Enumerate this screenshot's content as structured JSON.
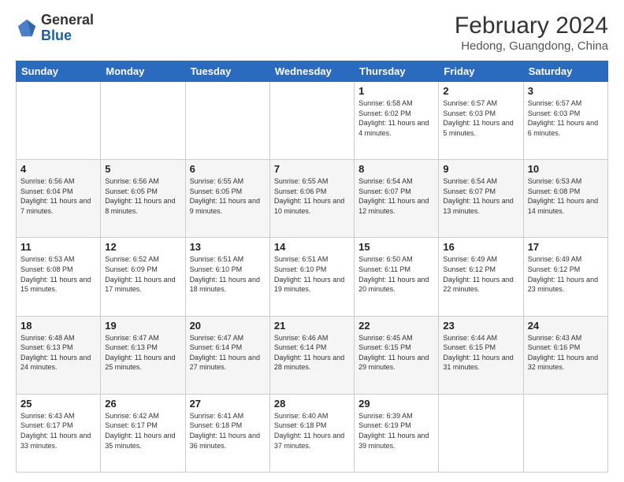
{
  "header": {
    "logo_general": "General",
    "logo_blue": "Blue",
    "month_year": "February 2024",
    "location": "Hedong, Guangdong, China"
  },
  "weekdays": [
    "Sunday",
    "Monday",
    "Tuesday",
    "Wednesday",
    "Thursday",
    "Friday",
    "Saturday"
  ],
  "weeks": [
    [
      {
        "day": "",
        "info": ""
      },
      {
        "day": "",
        "info": ""
      },
      {
        "day": "",
        "info": ""
      },
      {
        "day": "",
        "info": ""
      },
      {
        "day": "1",
        "info": "Sunrise: 6:58 AM\nSunset: 6:02 PM\nDaylight: 11 hours\nand 4 minutes."
      },
      {
        "day": "2",
        "info": "Sunrise: 6:57 AM\nSunset: 6:03 PM\nDaylight: 11 hours\nand 5 minutes."
      },
      {
        "day": "3",
        "info": "Sunrise: 6:57 AM\nSunset: 6:03 PM\nDaylight: 11 hours\nand 6 minutes."
      }
    ],
    [
      {
        "day": "4",
        "info": "Sunrise: 6:56 AM\nSunset: 6:04 PM\nDaylight: 11 hours\nand 7 minutes."
      },
      {
        "day": "5",
        "info": "Sunrise: 6:56 AM\nSunset: 6:05 PM\nDaylight: 11 hours\nand 8 minutes."
      },
      {
        "day": "6",
        "info": "Sunrise: 6:55 AM\nSunset: 6:05 PM\nDaylight: 11 hours\nand 9 minutes."
      },
      {
        "day": "7",
        "info": "Sunrise: 6:55 AM\nSunset: 6:06 PM\nDaylight: 11 hours\nand 10 minutes."
      },
      {
        "day": "8",
        "info": "Sunrise: 6:54 AM\nSunset: 6:07 PM\nDaylight: 11 hours\nand 12 minutes."
      },
      {
        "day": "9",
        "info": "Sunrise: 6:54 AM\nSunset: 6:07 PM\nDaylight: 11 hours\nand 13 minutes."
      },
      {
        "day": "10",
        "info": "Sunrise: 6:53 AM\nSunset: 6:08 PM\nDaylight: 11 hours\nand 14 minutes."
      }
    ],
    [
      {
        "day": "11",
        "info": "Sunrise: 6:53 AM\nSunset: 6:08 PM\nDaylight: 11 hours\nand 15 minutes."
      },
      {
        "day": "12",
        "info": "Sunrise: 6:52 AM\nSunset: 6:09 PM\nDaylight: 11 hours\nand 17 minutes."
      },
      {
        "day": "13",
        "info": "Sunrise: 6:51 AM\nSunset: 6:10 PM\nDaylight: 11 hours\nand 18 minutes."
      },
      {
        "day": "14",
        "info": "Sunrise: 6:51 AM\nSunset: 6:10 PM\nDaylight: 11 hours\nand 19 minutes."
      },
      {
        "day": "15",
        "info": "Sunrise: 6:50 AM\nSunset: 6:11 PM\nDaylight: 11 hours\nand 20 minutes."
      },
      {
        "day": "16",
        "info": "Sunrise: 6:49 AM\nSunset: 6:12 PM\nDaylight: 11 hours\nand 22 minutes."
      },
      {
        "day": "17",
        "info": "Sunrise: 6:49 AM\nSunset: 6:12 PM\nDaylight: 11 hours\nand 23 minutes."
      }
    ],
    [
      {
        "day": "18",
        "info": "Sunrise: 6:48 AM\nSunset: 6:13 PM\nDaylight: 11 hours\nand 24 minutes."
      },
      {
        "day": "19",
        "info": "Sunrise: 6:47 AM\nSunset: 6:13 PM\nDaylight: 11 hours\nand 25 minutes."
      },
      {
        "day": "20",
        "info": "Sunrise: 6:47 AM\nSunset: 6:14 PM\nDaylight: 11 hours\nand 27 minutes."
      },
      {
        "day": "21",
        "info": "Sunrise: 6:46 AM\nSunset: 6:14 PM\nDaylight: 11 hours\nand 28 minutes."
      },
      {
        "day": "22",
        "info": "Sunrise: 6:45 AM\nSunset: 6:15 PM\nDaylight: 11 hours\nand 29 minutes."
      },
      {
        "day": "23",
        "info": "Sunrise: 6:44 AM\nSunset: 6:15 PM\nDaylight: 11 hours\nand 31 minutes."
      },
      {
        "day": "24",
        "info": "Sunrise: 6:43 AM\nSunset: 6:16 PM\nDaylight: 11 hours\nand 32 minutes."
      }
    ],
    [
      {
        "day": "25",
        "info": "Sunrise: 6:43 AM\nSunset: 6:17 PM\nDaylight: 11 hours\nand 33 minutes."
      },
      {
        "day": "26",
        "info": "Sunrise: 6:42 AM\nSunset: 6:17 PM\nDaylight: 11 hours\nand 35 minutes."
      },
      {
        "day": "27",
        "info": "Sunrise: 6:41 AM\nSunset: 6:18 PM\nDaylight: 11 hours\nand 36 minutes."
      },
      {
        "day": "28",
        "info": "Sunrise: 6:40 AM\nSunset: 6:18 PM\nDaylight: 11 hours\nand 37 minutes."
      },
      {
        "day": "29",
        "info": "Sunrise: 6:39 AM\nSunset: 6:19 PM\nDaylight: 11 hours\nand 39 minutes."
      },
      {
        "day": "",
        "info": ""
      },
      {
        "day": "",
        "info": ""
      }
    ]
  ]
}
